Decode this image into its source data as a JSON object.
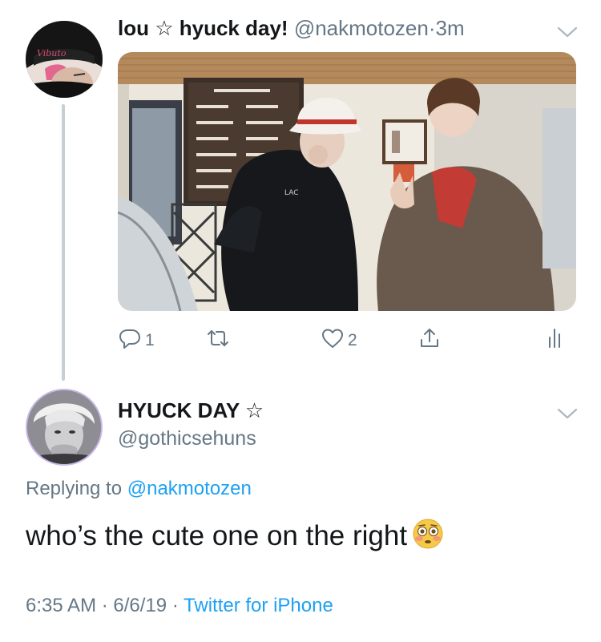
{
  "tweet": {
    "author_name": "lou ☆ hyuck day!",
    "author_handle": "@nakmotozen",
    "separator": "·",
    "age": "3m",
    "actions": {
      "reply_count": "1",
      "retweet_count": "",
      "like_count": "2"
    }
  },
  "reply": {
    "author_name": "HYUCK DAY ☆",
    "author_handle": "@gothicsehuns",
    "replying_prefix": "Replying to",
    "replying_to": "@nakmotozen",
    "text": "who’s the cute one on the right",
    "emoji": "flushed-face",
    "time": "6:35 AM",
    "date": "6/6/19",
    "dot": "·",
    "source": "Twitter for iPhone"
  },
  "colors": {
    "text": "#14171a",
    "secondary": "#657786",
    "link": "#1da1f2",
    "thread_line": "#c4cfd6"
  },
  "icons": [
    "reply-icon",
    "retweet-icon",
    "like-icon",
    "share-icon",
    "analytics-icon",
    "chevron-down-icon"
  ]
}
